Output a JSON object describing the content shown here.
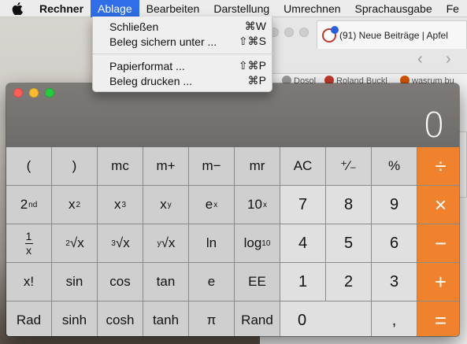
{
  "menubar": {
    "app_name": "Rechner",
    "items": [
      "Ablage",
      "Bearbeiten",
      "Darstellung",
      "Umrechnen",
      "Sprachausgabe",
      "Fe"
    ]
  },
  "dropdown": {
    "items": [
      {
        "label": "Schließen",
        "shortcut": "⌘W"
      },
      {
        "label": "Beleg sichern unter ...",
        "shortcut": "⇧⌘S"
      },
      {
        "label": "Papierformat ...",
        "shortcut": "⇧⌘P"
      },
      {
        "label": "Beleg drucken ...",
        "shortcut": "⌘P"
      }
    ]
  },
  "browser": {
    "tab_title": "(91) Neue Beiträge | Apfel",
    "bookmarks": [
      "Dosol",
      "Roland Buckl",
      "wasrum bu"
    ]
  },
  "calculator": {
    "display": "0",
    "keys": {
      "r1": [
        "(",
        ")",
        "mc",
        "m+",
        "m−",
        "mr",
        "AC",
        "⁺∕₋",
        "%",
        "÷"
      ],
      "r2_x2": "x",
      "r2_x3": "x",
      "r2_xy": "x",
      "r2_ex": "e",
      "r2_10x": "10",
      "r2": [
        "7",
        "8",
        "9",
        "×"
      ],
      "r3_ln": "ln",
      "r3_log": "log",
      "r3": [
        "4",
        "5",
        "6",
        "−"
      ],
      "r4": [
        "x!",
        "sin",
        "cos",
        "tan",
        "e",
        "EE",
        "1",
        "2",
        "3",
        "+"
      ],
      "r5": [
        "Rad",
        "sinh",
        "cosh",
        "tanh",
        "π",
        "Rand",
        "0",
        ",",
        "="
      ]
    },
    "colors": {
      "operator": "#f0812d",
      "display_bg": "#7a7775",
      "key_bg": "#d6d6d6"
    }
  }
}
